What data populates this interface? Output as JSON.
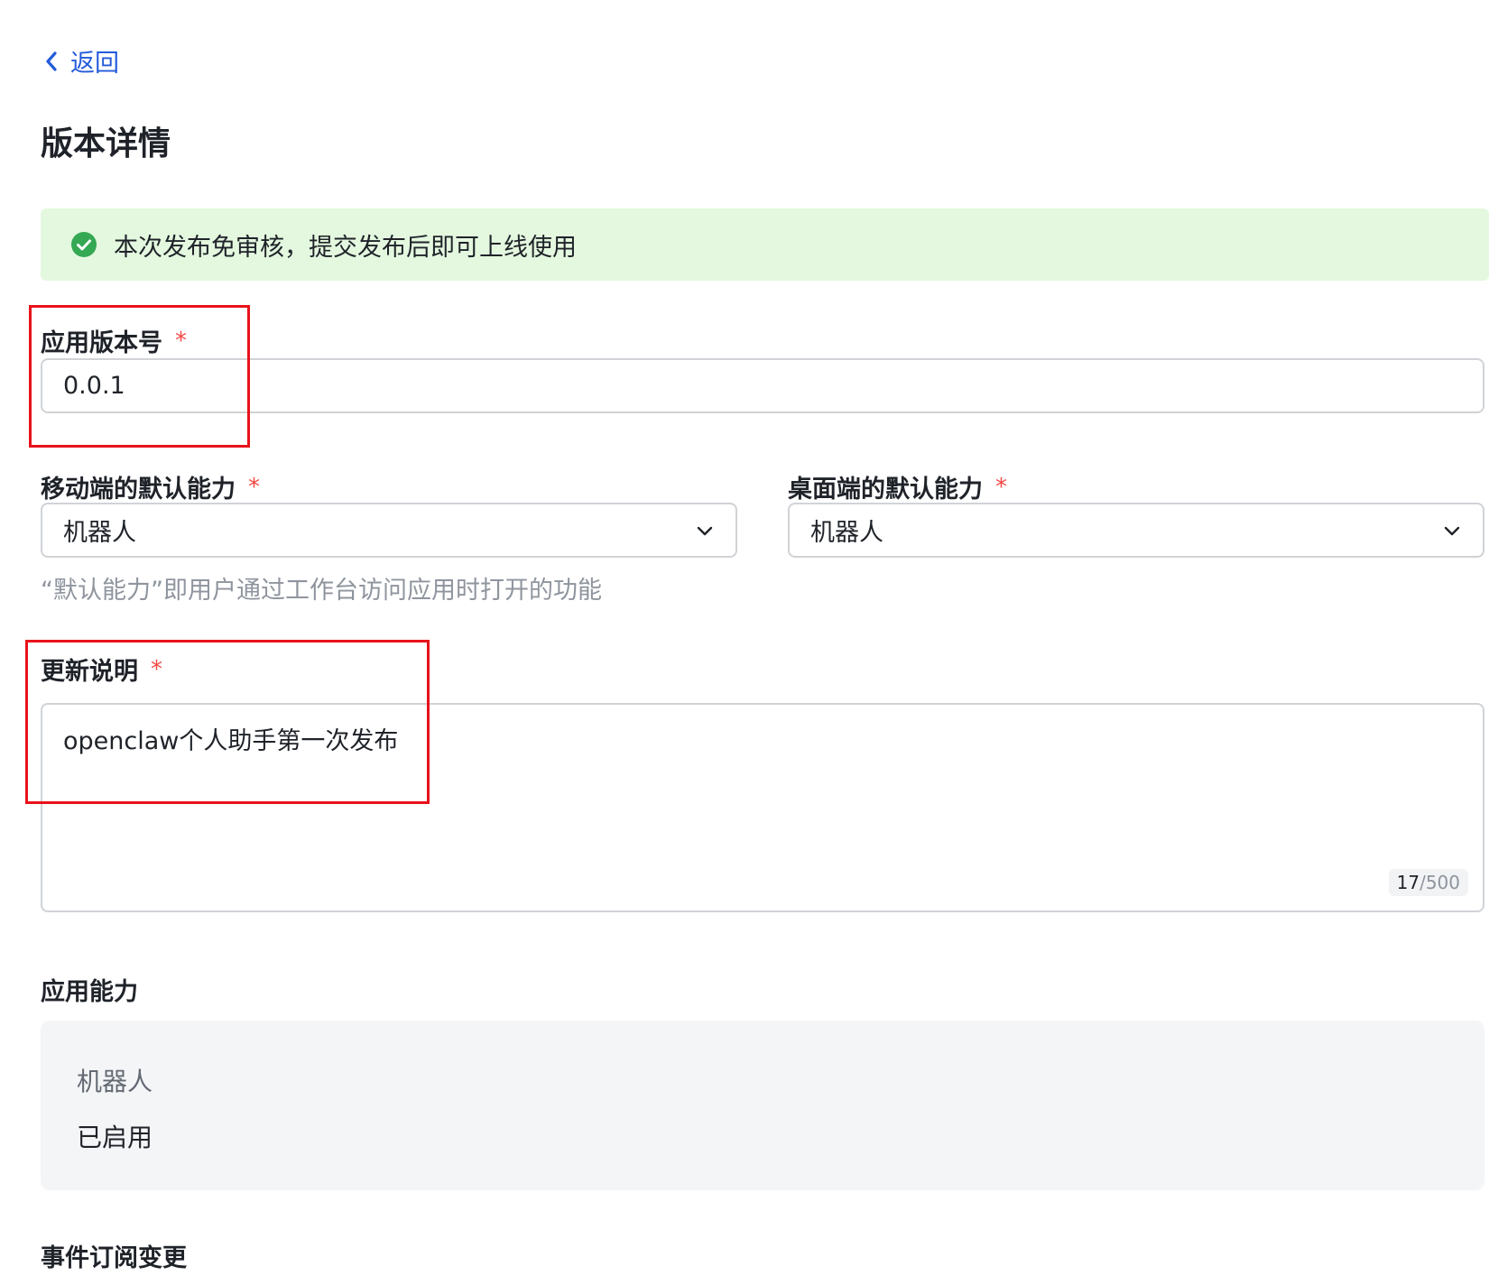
{
  "nav": {
    "back_label": "返回"
  },
  "page": {
    "title": "版本详情"
  },
  "notice": {
    "text": "本次发布免审核，提交发布后即可上线使用",
    "color": "#e4f8df"
  },
  "version_field": {
    "label": "应用版本号",
    "required_mark": "*",
    "value": "0.0.1"
  },
  "mobile_default": {
    "label": "移动端的默认能力",
    "required_mark": "*",
    "selected": "机器人"
  },
  "desktop_default": {
    "label": "桌面端的默认能力",
    "required_mark": "*",
    "selected": "机器人"
  },
  "default_hint": "“默认能力”即用户通过工作台访问应用时打开的功能",
  "release_notes": {
    "label": "更新说明",
    "required_mark": "*",
    "value": "openclaw个人助手第一次发布",
    "count": "17",
    "max": "/500"
  },
  "abilities": {
    "heading": "应用能力",
    "items": [
      {
        "name": "机器人",
        "status": "已启用"
      }
    ]
  },
  "event_subscription": {
    "heading": "事件订阅变更"
  },
  "colors": {
    "accent": "#245bdb",
    "required": "#f54a45",
    "success": "#34a853",
    "highlight_box": "#e8121b"
  }
}
